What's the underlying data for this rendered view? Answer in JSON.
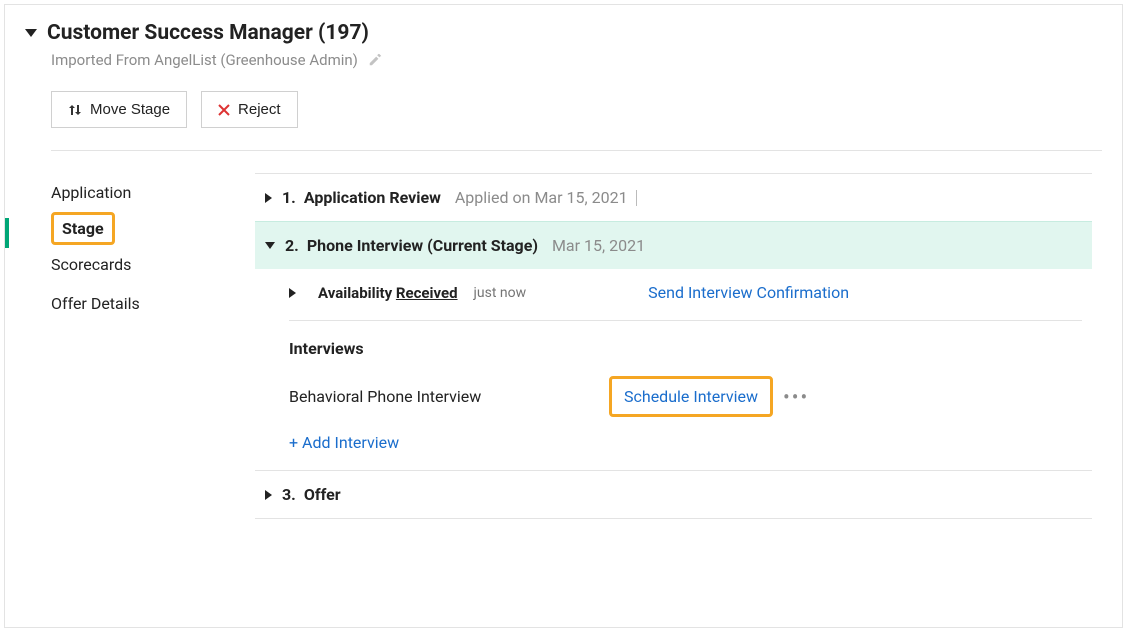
{
  "header": {
    "job_title": "Customer Success Manager (197)",
    "source": "Imported From AngelList (Greenhouse Admin)"
  },
  "actions": {
    "move_stage": "Move Stage",
    "reject": "Reject"
  },
  "nav": {
    "application": "Application",
    "stage": "Stage",
    "scorecards": "Scorecards",
    "offer_details": "Offer Details"
  },
  "stages": {
    "s1": {
      "num": "1.",
      "name": "Application Review",
      "meta": "Applied on Mar 15, 2021"
    },
    "s2": {
      "num": "2.",
      "name": "Phone Interview (Current Stage)",
      "meta": "Mar 15, 2021"
    },
    "s3": {
      "num": "3.",
      "name": "Offer"
    }
  },
  "availability": {
    "label": "Availability",
    "status": "Received",
    "when": "just now",
    "send_link": "Send Interview Confirmation"
  },
  "interviews": {
    "title": "Interviews",
    "item1": "Behavioral Phone Interview",
    "schedule": "Schedule Interview",
    "add": "+ Add Interview"
  }
}
